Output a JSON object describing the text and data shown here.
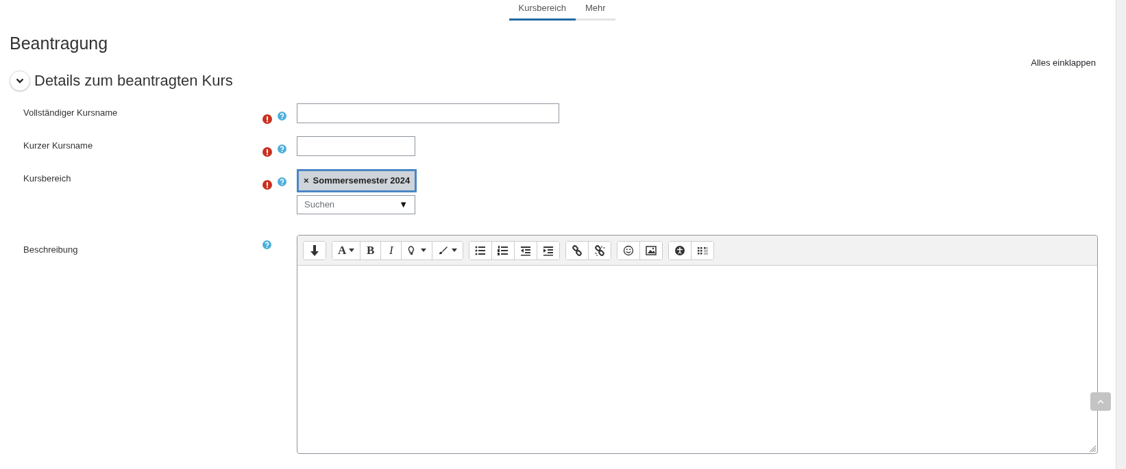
{
  "tabs": [
    {
      "label": "Kursbereich",
      "selected": true
    },
    {
      "label": "Mehr",
      "selected": false
    }
  ],
  "page_title": "Beantragung",
  "collapse_all": "Alles einklappen",
  "section": {
    "title": "Details zum beantragten Kurs",
    "expanded": true,
    "fields": [
      {
        "kind": "text",
        "label": "Vollständiger Kursname",
        "required": true,
        "help": true
      },
      {
        "kind": "short",
        "label": "Kurzer Kursname",
        "required": true,
        "help": true
      },
      {
        "kind": "autocomplete",
        "label": "Kursbereich",
        "required": true,
        "help": true,
        "selection": [
          {
            "remove": "×",
            "label": "Sommersemester 2024"
          }
        ],
        "placeholder": "Suchen",
        "arrow": "▼"
      },
      {
        "kind": "editor",
        "label": "Beschreibung",
        "required": false,
        "help": true,
        "toolbar": [
          [
            {
              "kind": "icon"
            }
          ],
          [
            {
              "kind": "text",
              "label": "A",
              "dropdown": true
            },
            {
              "kind": "text",
              "label": "B",
              "dropdown": false
            },
            {
              "kind": "text",
              "label": "I",
              "dropdown": false
            },
            {
              "kind": "icon",
              "dropdown": true
            },
            {
              "kind": "icon",
              "dropdown": true
            }
          ],
          [
            {
              "kind": "icon"
            },
            {
              "kind": "icon"
            },
            {
              "kind": "icon"
            },
            {
              "kind": "icon"
            }
          ],
          [
            {
              "kind": "icon"
            },
            {
              "kind": "icon"
            }
          ],
          [
            {
              "kind": "icon"
            },
            {
              "kind": "icon"
            }
          ],
          [
            {
              "kind": "icon"
            },
            {
              "kind": "icon"
            }
          ]
        ]
      }
    ]
  }
}
